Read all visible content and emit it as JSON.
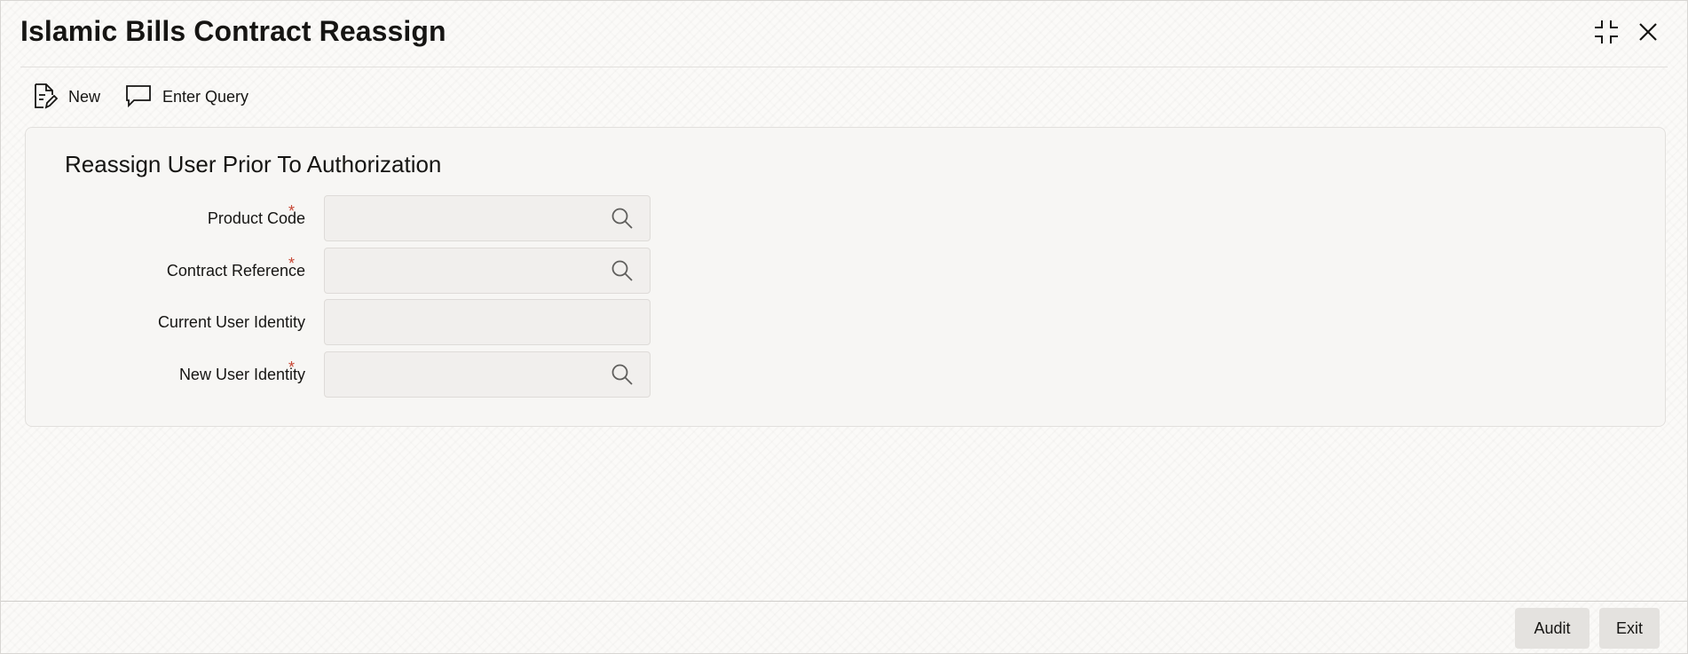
{
  "window": {
    "title": "Islamic Bills Contract Reassign"
  },
  "toolbar": {
    "new_label": "New",
    "enter_query_label": "Enter Query"
  },
  "section": {
    "title": "Reassign User Prior To Authorization"
  },
  "fields": {
    "product_code": {
      "label": "Product Code",
      "required": "*",
      "value": ""
    },
    "contract_reference": {
      "label": "Contract Reference",
      "required": "*",
      "value": ""
    },
    "current_user_identity": {
      "label": "Current User Identity",
      "value": ""
    },
    "new_user_identity": {
      "label": "New User Identity",
      "required": "*",
      "value": ""
    }
  },
  "footer": {
    "audit_label": "Audit",
    "exit_label": "Exit"
  },
  "colors": {
    "required_star": "#c74634",
    "text": "#161513",
    "panel_bg": "#f7f6f4",
    "input_bg": "#f1efed",
    "footer_button_bg": "#e4e2df"
  },
  "icons": {
    "new": "document-edit-icon",
    "enter_query": "chat-bubble-icon",
    "lov": "search-icon",
    "collapse": "collapse-icon",
    "close": "close-icon"
  }
}
